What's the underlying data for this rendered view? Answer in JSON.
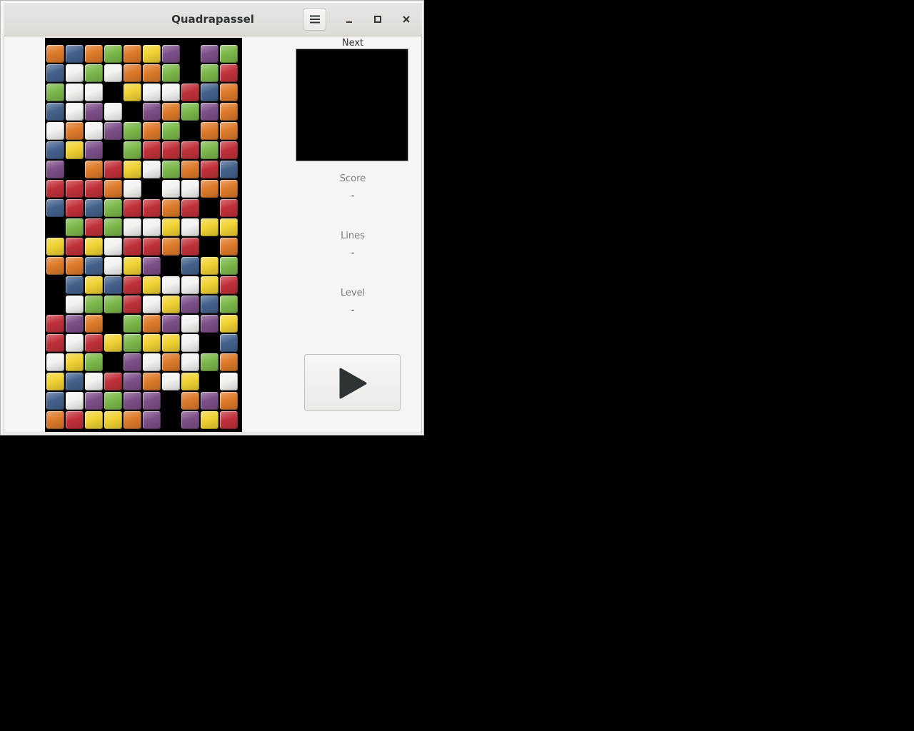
{
  "window": {
    "title": "Quadrapassel"
  },
  "titlebar": {
    "menu_icon": "hamburger-menu-icon",
    "minimize_icon": "minimize-icon",
    "maximize_icon": "maximize-icon",
    "close_icon": "close-icon"
  },
  "sidebar": {
    "next_label": "Next",
    "score_label": "Score",
    "score_value": "-",
    "lines_label": "Lines",
    "lines_value": "-",
    "level_label": "Level",
    "level_value": "-",
    "play_icon": "play-icon"
  },
  "board": {
    "columns": 10,
    "rows": 20,
    "colors": {
      "O": "#de7a2a",
      "B": "#44628c",
      "G": "#7cb84a",
      "Y": "#f0d233",
      "P": "#7d4f88",
      "W": "#f3f3f0",
      "R": "#c1313a"
    },
    "grid": [
      "OBOGOYP.PG",
      "BWGWOOG.GR",
      "GWW.YWWRBO",
      "BWPW.POGPO",
      "WOWPGOG.OO",
      "BYP.GRRRGR",
      "P.ORYWGORB",
      "RRROW.WWOO",
      "BRBGRROR.R",
      ".GRGWWYWYY",
      "YRYWRROR.O",
      "OOBWYP.BYG",
      ".BYBRYWWYR",
      ".WGGRWYPBG",
      "RPO.GOPWPY",
      "RWRYGYYW.B",
      "WYG.PWOWGO",
      "YBWRPOWY.W",
      "BWPGPP.OPO",
      "ORYYOP.PYR"
    ]
  }
}
